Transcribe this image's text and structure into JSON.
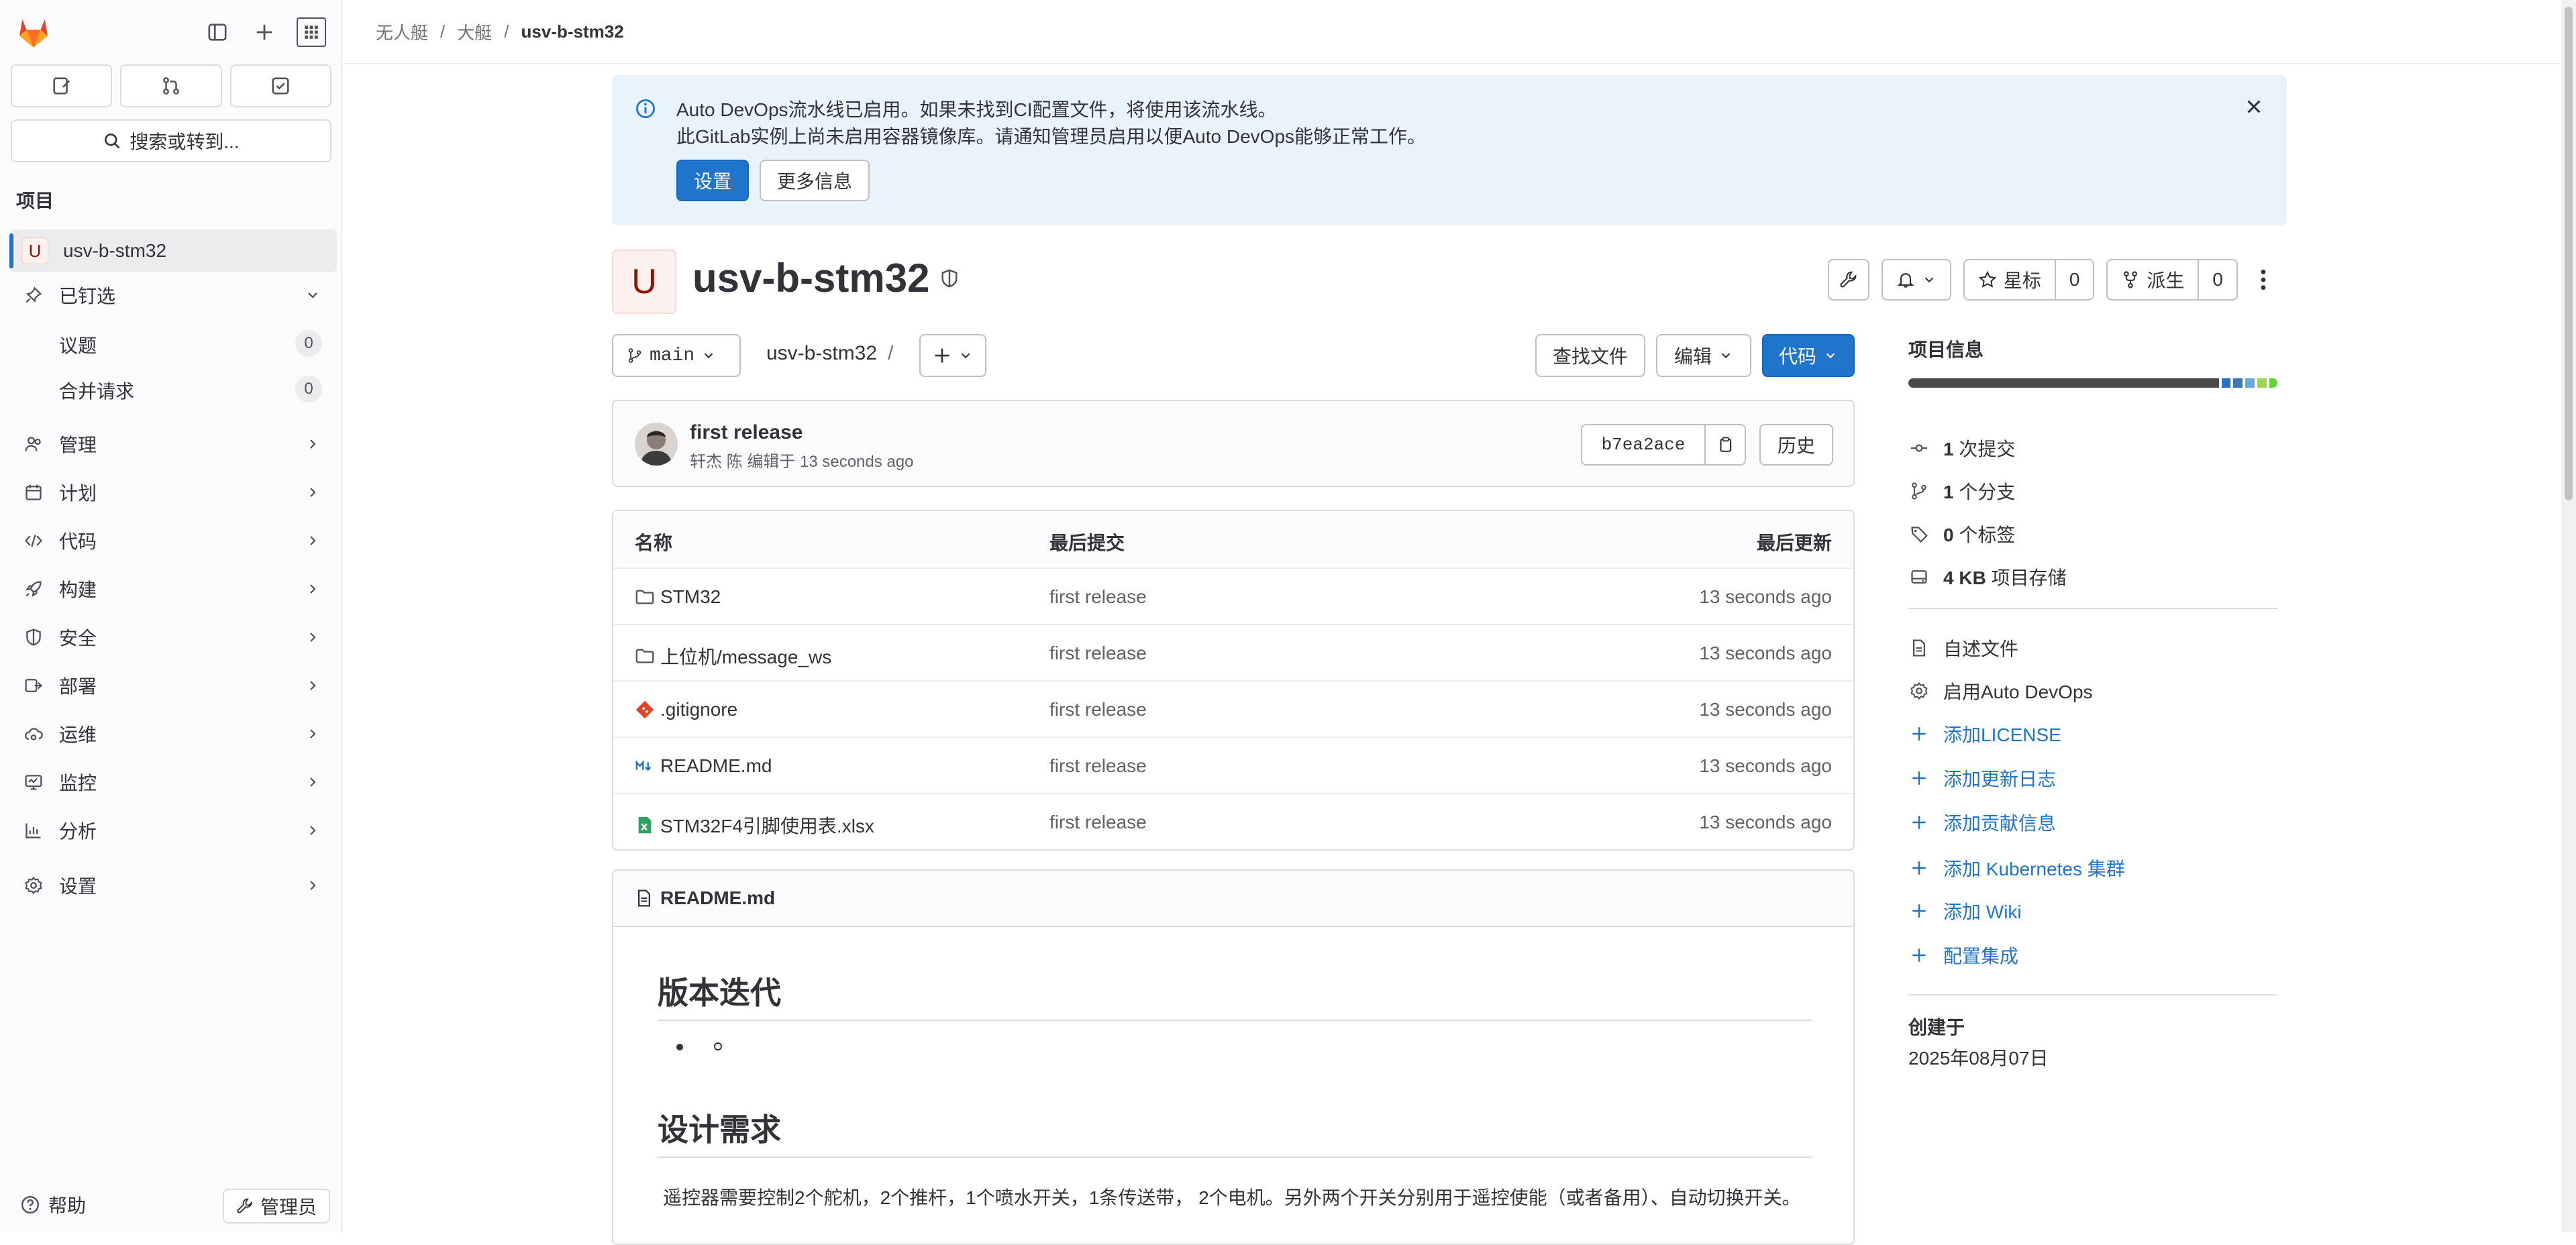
{
  "sidebar": {
    "search_label": "搜索或转到...",
    "section_label": "项目",
    "project_name": "usv-b-stm32",
    "project_initial": "U",
    "pinned_label": "已钉选",
    "pinned_items": [
      {
        "label": "议题",
        "count": "0"
      },
      {
        "label": "合并请求",
        "count": "0"
      }
    ],
    "nav_items": [
      {
        "label": "管理",
        "icon": "users-icon"
      },
      {
        "label": "计划",
        "icon": "calendar-icon"
      },
      {
        "label": "代码",
        "icon": "code-icon"
      },
      {
        "label": "构建",
        "icon": "rocket-icon"
      },
      {
        "label": "安全",
        "icon": "shield-icon"
      },
      {
        "label": "部署",
        "icon": "deployments-icon"
      },
      {
        "label": "运维",
        "icon": "cloud-gear-icon"
      },
      {
        "label": "监控",
        "icon": "monitor-icon"
      },
      {
        "label": "分析",
        "icon": "chart-icon"
      },
      {
        "label": "设置",
        "icon": "settings-icon"
      }
    ],
    "help_label": "帮助",
    "admin_label": "管理员"
  },
  "breadcrumb": [
    "无人艇",
    "大艇",
    "usv-b-stm32"
  ],
  "banner": {
    "line1": "Auto DevOps流水线已启用。如果未找到CI配置文件，将使用该流水线。",
    "line2": "此GitLab实例上尚未启用容器镜像库。请通知管理员启用以便Auto DevOps能够正常工作。",
    "primary_label": "设置",
    "secondary_label": "更多信息"
  },
  "project": {
    "initial": "U",
    "title": "usv-b-stm32",
    "star_label": "星标",
    "star_count": "0",
    "fork_label": "派生",
    "fork_count": "0"
  },
  "repo": {
    "branch": "main",
    "path": "usv-b-stm32",
    "path_sep": "/",
    "find_file_label": "查找文件",
    "edit_label": "编辑",
    "code_label": "代码"
  },
  "commit": {
    "message": "first release",
    "meta": "轩杰 陈 编辑于 13 seconds ago",
    "sha": "b7ea2ace",
    "history_label": "历史"
  },
  "files": {
    "headers": [
      "名称",
      "最后提交",
      "最后更新"
    ],
    "rows": [
      {
        "name": "STM32",
        "icon": "folder-icon",
        "commit": "first release",
        "updated": "13 seconds ago"
      },
      {
        "name": "上位机/message_ws",
        "icon": "folder-icon",
        "commit": "first release",
        "updated": "13 seconds ago"
      },
      {
        "name": ".gitignore",
        "icon": "git-icon",
        "commit": "first release",
        "updated": "13 seconds ago"
      },
      {
        "name": "README.md",
        "icon": "markdown-icon",
        "commit": "first release",
        "updated": "13 seconds ago"
      },
      {
        "name": "STM32F4引脚使用表.xlsx",
        "icon": "spreadsheet-icon",
        "commit": "first release",
        "updated": "13 seconds ago"
      }
    ]
  },
  "readme": {
    "filename": "README.md",
    "heading1": "版本迭代",
    "heading2": "设计需求",
    "paragraph": "遥控器需要控制2个舵机，2个推杆，1个喷水开关，1条传送带， 2个电机。另外两个开关分别用于遥控使能（或者备用）、自动切换开关。"
  },
  "project_info": {
    "title": "项目信息",
    "language_colors": [
      "#4a4a4a",
      "#1f75cb",
      "#3e76b0",
      "#6fa8dc",
      "#9fd356",
      "#62d332"
    ],
    "stats": [
      {
        "value": "1",
        "label": "次提交",
        "icon": "commit-icon"
      },
      {
        "value": "1",
        "label": "个分支",
        "icon": "branch-icon"
      },
      {
        "value": "0",
        "label": "个标签",
        "icon": "tag-icon"
      },
      {
        "value": "4 KB",
        "label": "项目存储",
        "icon": "storage-icon"
      }
    ],
    "links": [
      {
        "label": "自述文件",
        "icon": "doc-icon",
        "kind": "plain"
      },
      {
        "label": "启用Auto DevOps",
        "icon": "settings-icon",
        "kind": "plain"
      },
      {
        "label": "添加LICENSE",
        "icon": "plus-icon",
        "kind": "link"
      },
      {
        "label": "添加更新日志",
        "icon": "plus-icon",
        "kind": "link"
      },
      {
        "label": "添加贡献信息",
        "icon": "plus-icon",
        "kind": "link"
      },
      {
        "label": "添加 Kubernetes 集群",
        "icon": "plus-icon",
        "kind": "link"
      },
      {
        "label": "添加 Wiki",
        "icon": "plus-icon",
        "kind": "link"
      },
      {
        "label": "配置集成",
        "icon": "plus-icon",
        "kind": "link"
      }
    ],
    "created_label": "创建于",
    "created_date": "2025年08月07日"
  }
}
